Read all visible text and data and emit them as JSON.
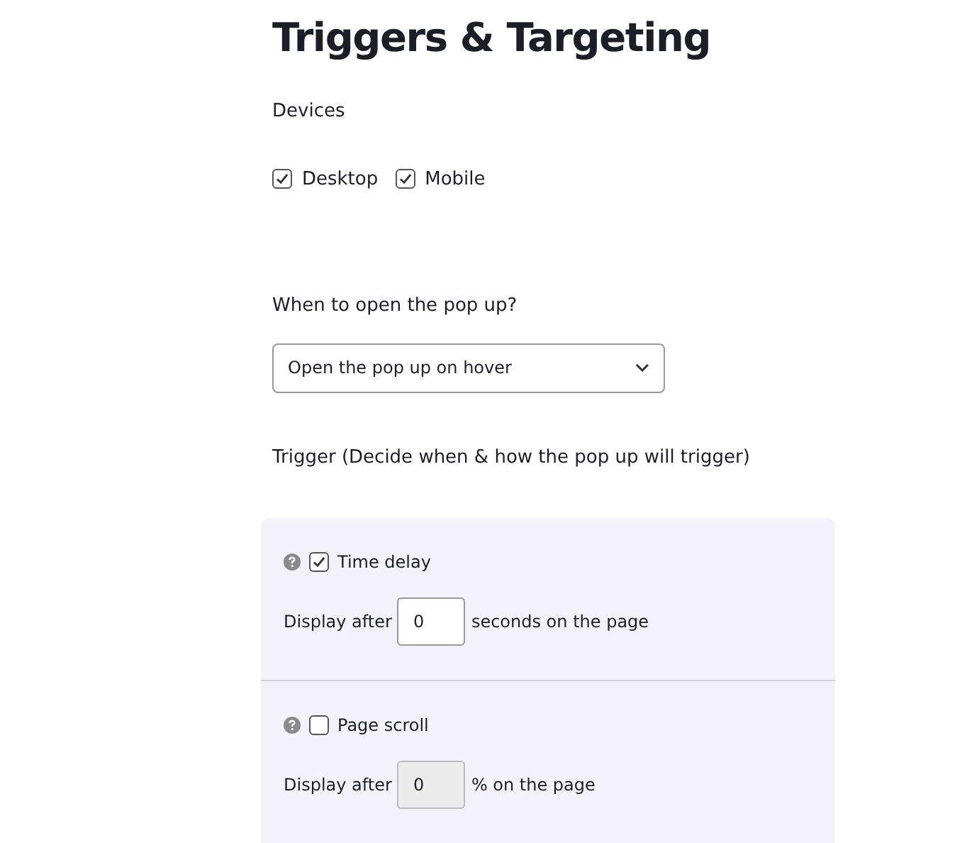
{
  "title": "Triggers & Targeting",
  "devices": {
    "label": "Devices",
    "options": [
      {
        "label": "Desktop",
        "checked": true
      },
      {
        "label": "Mobile",
        "checked": true
      }
    ]
  },
  "open_select": {
    "label": "When to open the pop up?",
    "value": "Open the pop up on hover"
  },
  "trigger_heading": "Trigger (Decide when & how the pop up will trigger)",
  "triggers": [
    {
      "label": "Time delay",
      "checked": true,
      "prefix": "Display after",
      "value": "0",
      "disabled": false,
      "suffix": "seconds on the page"
    },
    {
      "label": "Page scroll",
      "checked": false,
      "prefix": "Display after",
      "value": "0",
      "disabled": true,
      "suffix": "% on the page"
    }
  ]
}
